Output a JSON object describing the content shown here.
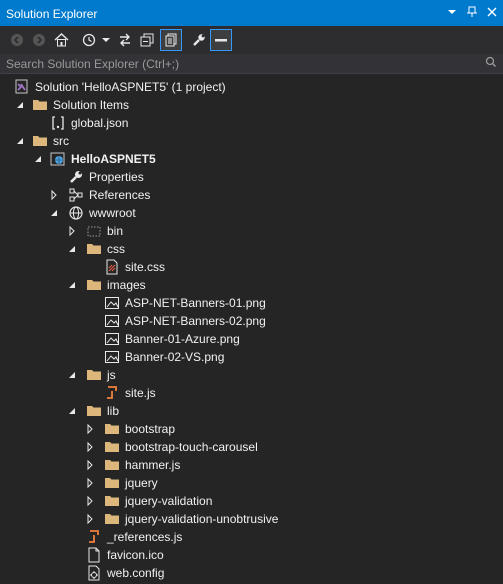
{
  "window": {
    "title": "Solution Explorer"
  },
  "search": {
    "placeholder": "Search Solution Explorer (Ctrl+;)"
  },
  "tree": {
    "solution": "Solution 'HelloASPNET5' (1 project)",
    "solution_items": "Solution Items",
    "global_json": "global.json",
    "src": "src",
    "project": "HelloASPNET5",
    "properties": "Properties",
    "references": "References",
    "wwwroot": "wwwroot",
    "bin": "bin",
    "css": "css",
    "site_css": "site.css",
    "images": "images",
    "img1": "ASP-NET-Banners-01.png",
    "img2": "ASP-NET-Banners-02.png",
    "img3": "Banner-01-Azure.png",
    "img4": "Banner-02-VS.png",
    "js": "js",
    "site_js": "site.js",
    "lib": "lib",
    "bootstrap": "bootstrap",
    "bootstrap_touch_carousel": "bootstrap-touch-carousel",
    "hammer": "hammer.js",
    "jquery": "jquery",
    "jquery_validation": "jquery-validation",
    "jquery_validation_unobtrusive": "jquery-validation-unobtrusive",
    "references_js": "_references.js",
    "favicon": "favicon.ico",
    "web_config": "web.config"
  }
}
